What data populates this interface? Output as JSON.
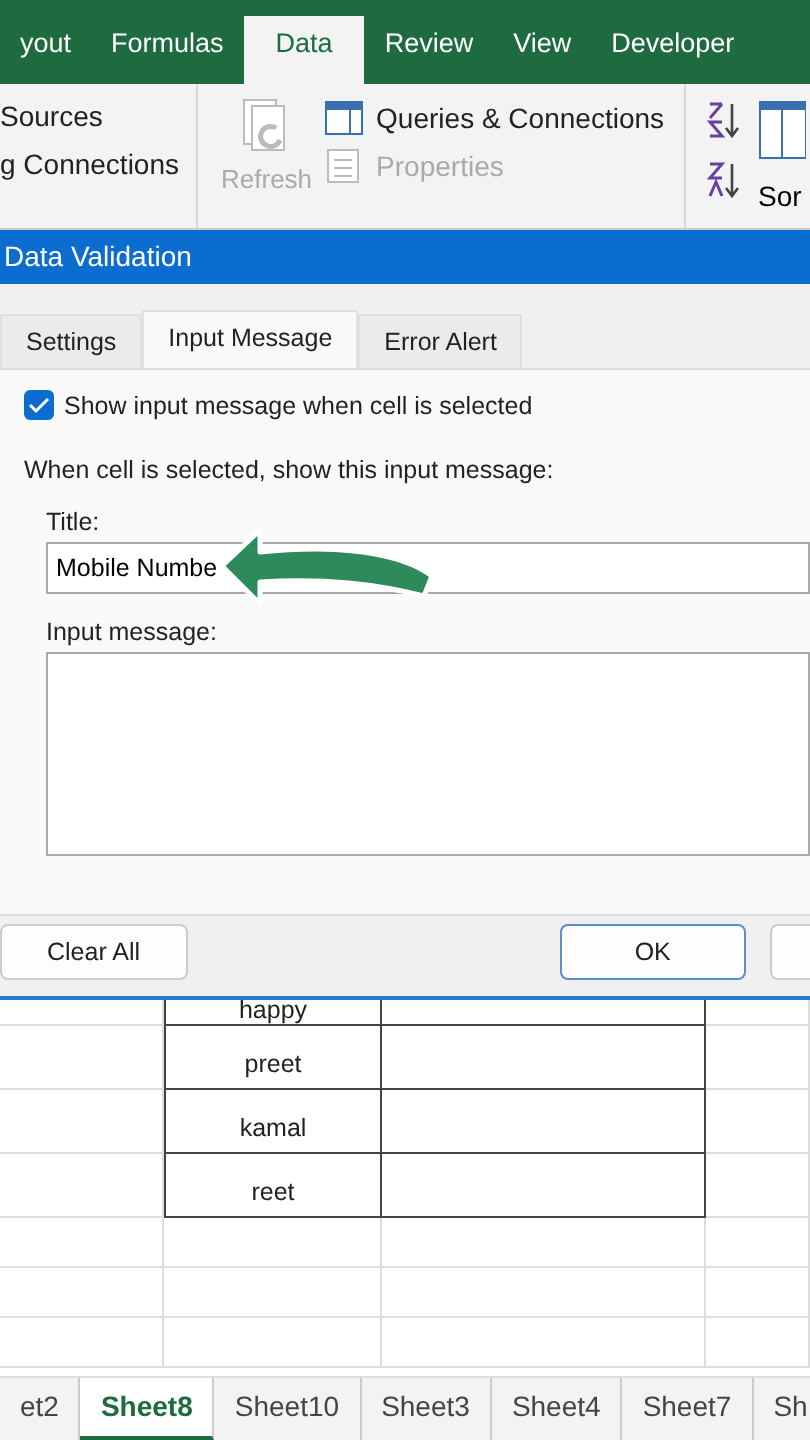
{
  "ribbon_tabs": [
    {
      "label": "yout",
      "selected": false
    },
    {
      "label": "Formulas",
      "selected": false
    },
    {
      "label": "Data",
      "selected": true
    },
    {
      "label": "Review",
      "selected": false
    },
    {
      "label": "View",
      "selected": false
    },
    {
      "label": "Developer",
      "selected": false
    }
  ],
  "ribbon": {
    "left_items": [
      "Sources",
      "g Connections"
    ],
    "refresh": {
      "label": "Refresh",
      "disabled": true
    },
    "items": [
      {
        "label": "Queries & Connections",
        "disabled": false
      },
      {
        "label": "Properties",
        "disabled": true
      }
    ],
    "sort": {
      "label": "Sor"
    }
  },
  "dialog": {
    "title": "Data Validation",
    "tabs": [
      {
        "label": "Settings",
        "selected": false
      },
      {
        "label": "Input Message",
        "selected": true
      },
      {
        "label": "Error Alert",
        "selected": false
      }
    ],
    "show_message": {
      "label": "Show input message when cell is selected",
      "checked": true
    },
    "group_label": "When cell is selected, show this input message:",
    "title_field": {
      "label": "Title:",
      "value": "Mobile Numbe"
    },
    "message_field": {
      "label": "Input message:"
    },
    "buttons": [
      {
        "label": "Clear All",
        "kind": "left"
      },
      {
        "label": "OK",
        "kind": "default"
      },
      {
        "kind": "clipped"
      }
    ]
  },
  "sheet": {
    "rows": [
      {
        "name": "happy"
      },
      {
        "name": "preet"
      },
      {
        "name": "kamal"
      },
      {
        "name": "reet"
      }
    ]
  },
  "sheet_tabs": [
    {
      "label": "et2",
      "selected": false
    },
    {
      "label": "Sheet8",
      "selected": true
    },
    {
      "label": "Sheet10",
      "selected": false
    },
    {
      "label": "Sheet3",
      "selected": false
    },
    {
      "label": "Sheet4",
      "selected": false
    },
    {
      "label": "Sheet7",
      "selected": false
    },
    {
      "label": "Sh",
      "selected": false
    }
  ]
}
